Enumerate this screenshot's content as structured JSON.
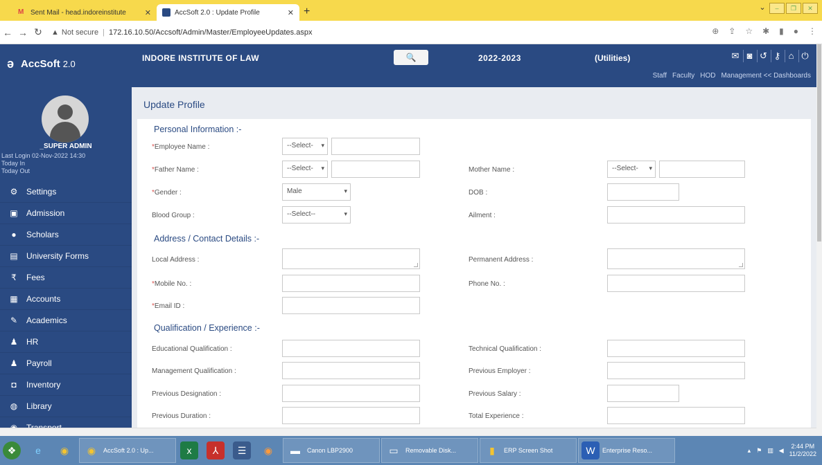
{
  "browser": {
    "tabs": [
      {
        "title": "Sent Mail - head.indoreinstitute",
        "icon": "gmail-icon"
      },
      {
        "title": "AccSoft 2.0 : Update Profile",
        "icon": "page-icon"
      }
    ],
    "url_warning": "Not secure",
    "url": "172.16.10.50/Accsoft/Admin/Master/EmployeeUpdates.aspx"
  },
  "header": {
    "brand": "AccSoft",
    "version": "2.0",
    "institute": "INDORE INSTITUTE OF LAW",
    "session": "2022-2023",
    "module": "(Utilities)",
    "links": [
      "Staff",
      "Faculty",
      "HOD",
      "Management << Dashboards"
    ]
  },
  "user": {
    "name": "_SUPER ADMIN",
    "last_login": "Last Login  02-Nov-2022 14:30",
    "today_in": "Today In",
    "today_out": "Today Out"
  },
  "sidebar": {
    "items": [
      {
        "label": "Settings",
        "icon": "gear-icon"
      },
      {
        "label": "Admission",
        "icon": "admission-icon"
      },
      {
        "label": "Scholars",
        "icon": "user-icon"
      },
      {
        "label": "University Forms",
        "icon": "form-icon"
      },
      {
        "label": "Fees",
        "icon": "rupee-icon"
      },
      {
        "label": "Accounts",
        "icon": "ledger-icon"
      },
      {
        "label": "Academics",
        "icon": "pen-icon"
      },
      {
        "label": "HR",
        "icon": "users-icon"
      },
      {
        "label": "Payroll",
        "icon": "users-icon"
      },
      {
        "label": "Inventory",
        "icon": "box-icon"
      },
      {
        "label": "Library",
        "icon": "book-icon"
      },
      {
        "label": "Transport",
        "icon": "bus-icon"
      }
    ]
  },
  "page": {
    "title": "Update Profile",
    "sections": {
      "personal": "Personal Information :-",
      "address": "Address / Contact Details :-",
      "qualification": "Qualification / Experience :-"
    },
    "fields": {
      "employee_name": "Employee Name :",
      "father_name": "Father Name :",
      "mother_name": "Mother Name :",
      "gender": "Gender :",
      "dob": "DOB :",
      "blood_group": "Blood Group :",
      "ailment": "Ailment :",
      "local_address": "Local Address :",
      "permanent_address": "Permanent Address :",
      "mobile": "Mobile No. :",
      "phone": "Phone No. :",
      "email": "Email ID :",
      "edu_qual": "Educational Qualification :",
      "tech_qual": "Technical Qualification :",
      "mgmt_qual": "Management Qualification :",
      "prev_employer": "Previous Employer :",
      "prev_designation": "Previous Designation :",
      "prev_salary": "Previous Salary :",
      "prev_duration": "Previous Duration :",
      "total_experience": "Total Experience :"
    },
    "selects": {
      "title_select": "--Select-",
      "gender_value": "Male",
      "blood_group_value": "--Select--"
    }
  },
  "taskbar": {
    "windows": [
      "AccSoft 2.0 : Up...",
      "Canon LBP2900",
      "Removable Disk...",
      "ERP Screen Shot",
      "Enterprise Reso..."
    ],
    "time": "2:44 PM",
    "date": "11/2/2022"
  },
  "colors": {
    "header": "#2a4a82",
    "tabbar": "#f7d94c",
    "required": "#d9534f"
  }
}
